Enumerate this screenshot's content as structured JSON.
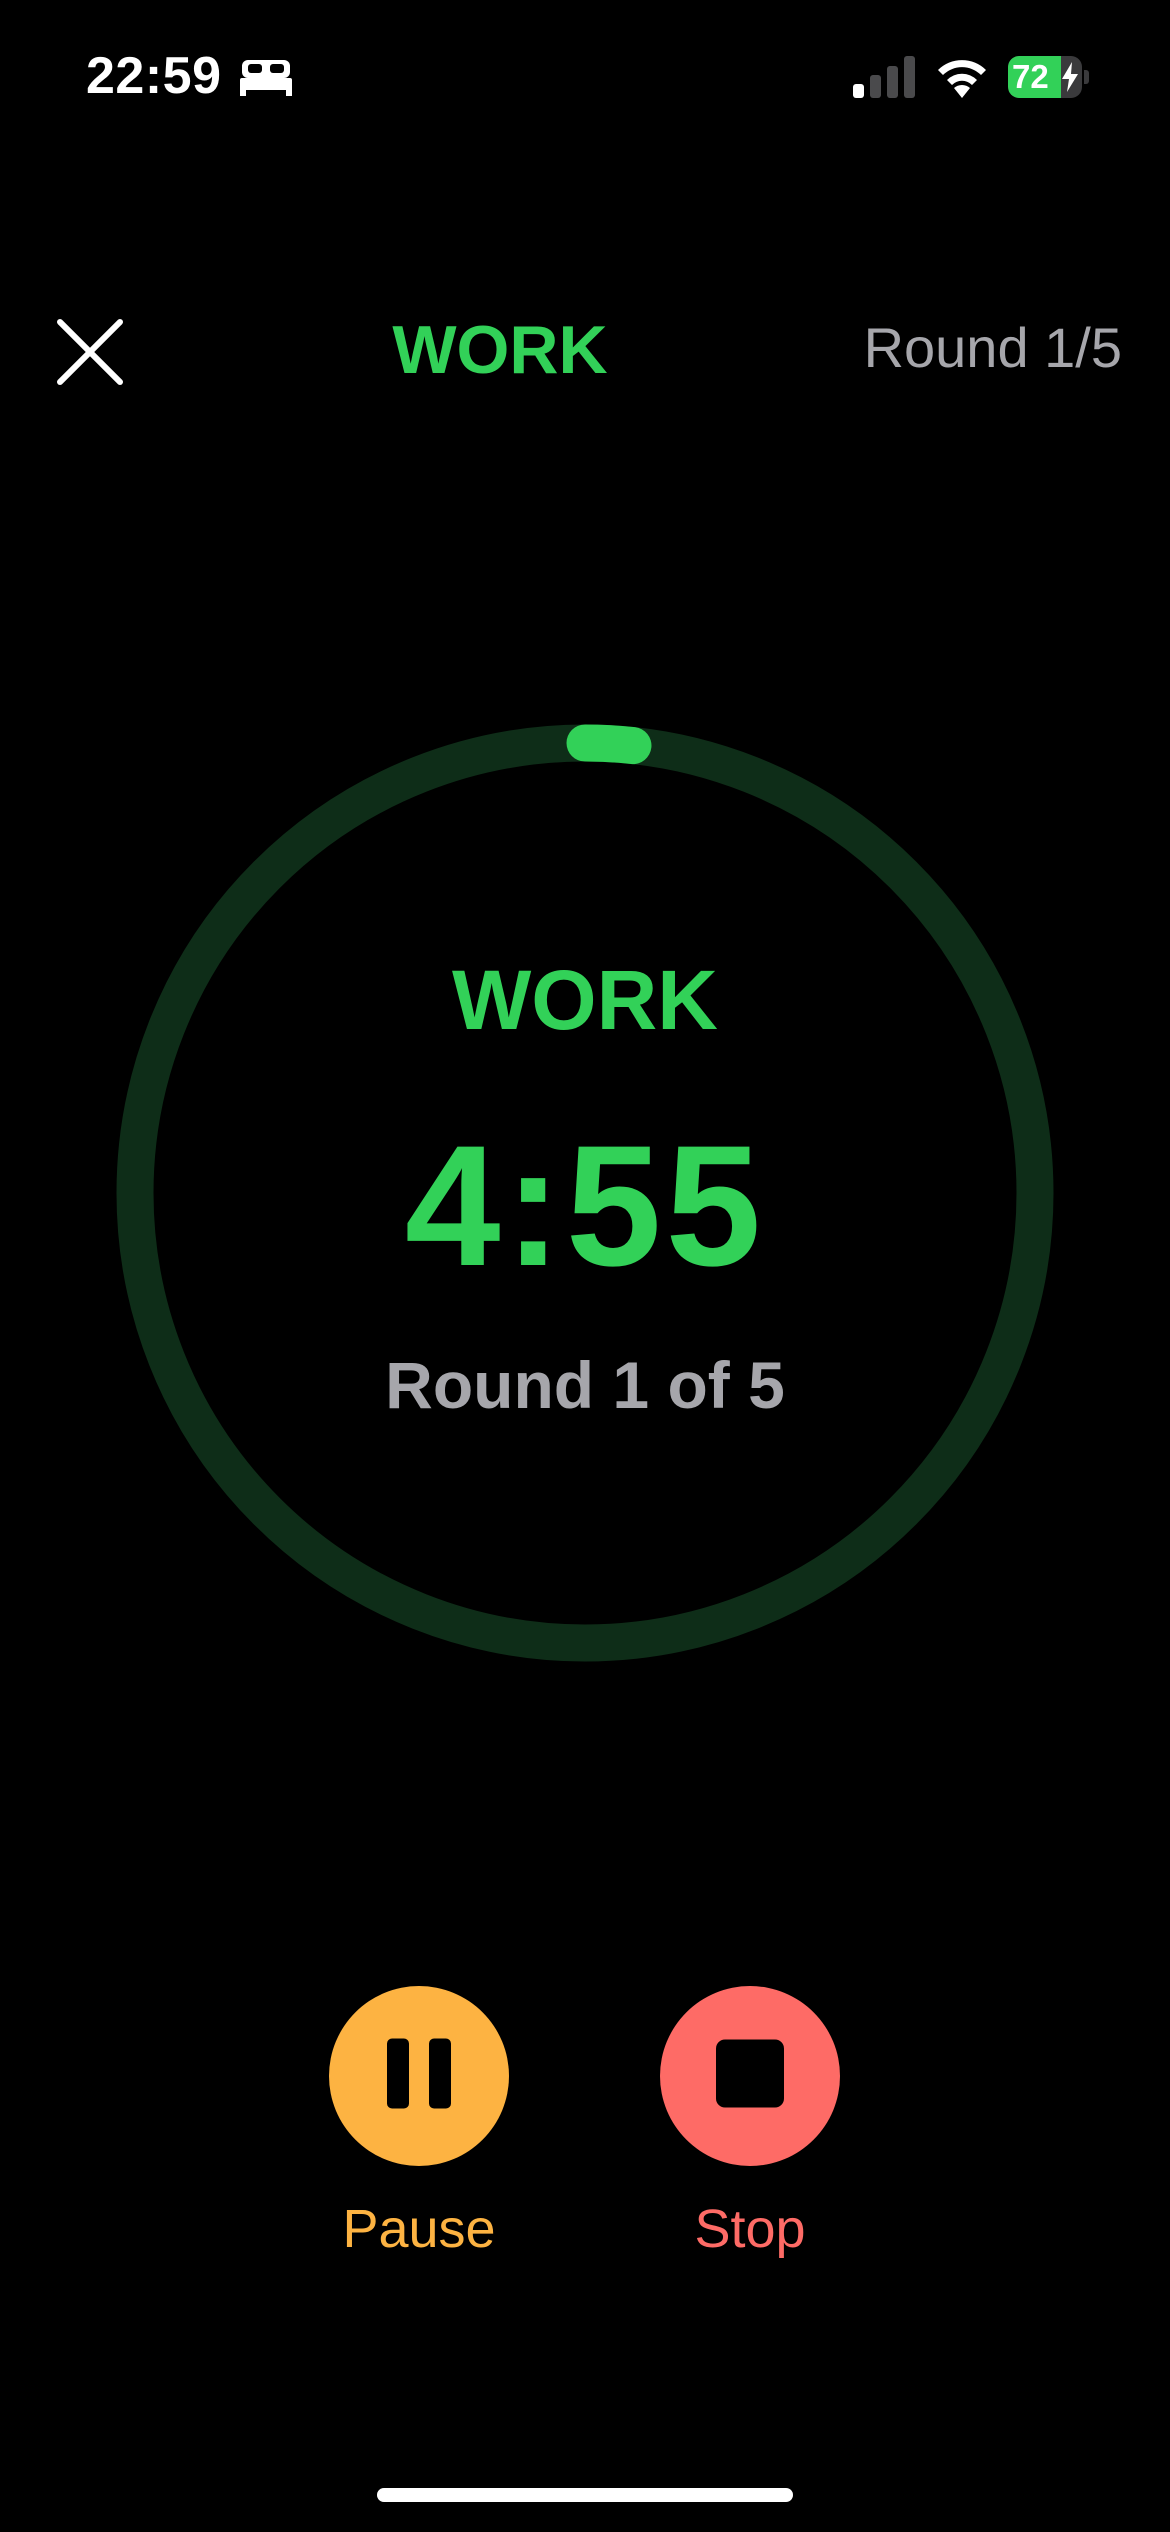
{
  "status_bar": {
    "time": "22:59",
    "battery_level": "72",
    "battery_fraction": 0.72,
    "signal_bars_active": 1,
    "signal_bars_total": 4
  },
  "header": {
    "title": "WORK",
    "round_label": "Round 1/5"
  },
  "timer": {
    "phase": "WORK",
    "time_remaining": "4:55",
    "round_text": "Round 1 of 5",
    "progress_fraction": 0.017
  },
  "controls": {
    "pause_label": "Pause",
    "stop_label": "Stop"
  },
  "icons": {
    "close": "close-icon",
    "pause": "pause-icon",
    "stop": "stop-icon",
    "sleep": "bed-icon",
    "signal": "signal-icon",
    "wifi": "wifi-icon",
    "battery": "battery-icon"
  },
  "colors": {
    "accent_green": "#32d158",
    "ring_track": "#0e2d18",
    "pause_orange": "#fdb342",
    "stop_red": "#fe6b66",
    "secondary_gray": "#a6a6ab",
    "background": "#000000"
  }
}
